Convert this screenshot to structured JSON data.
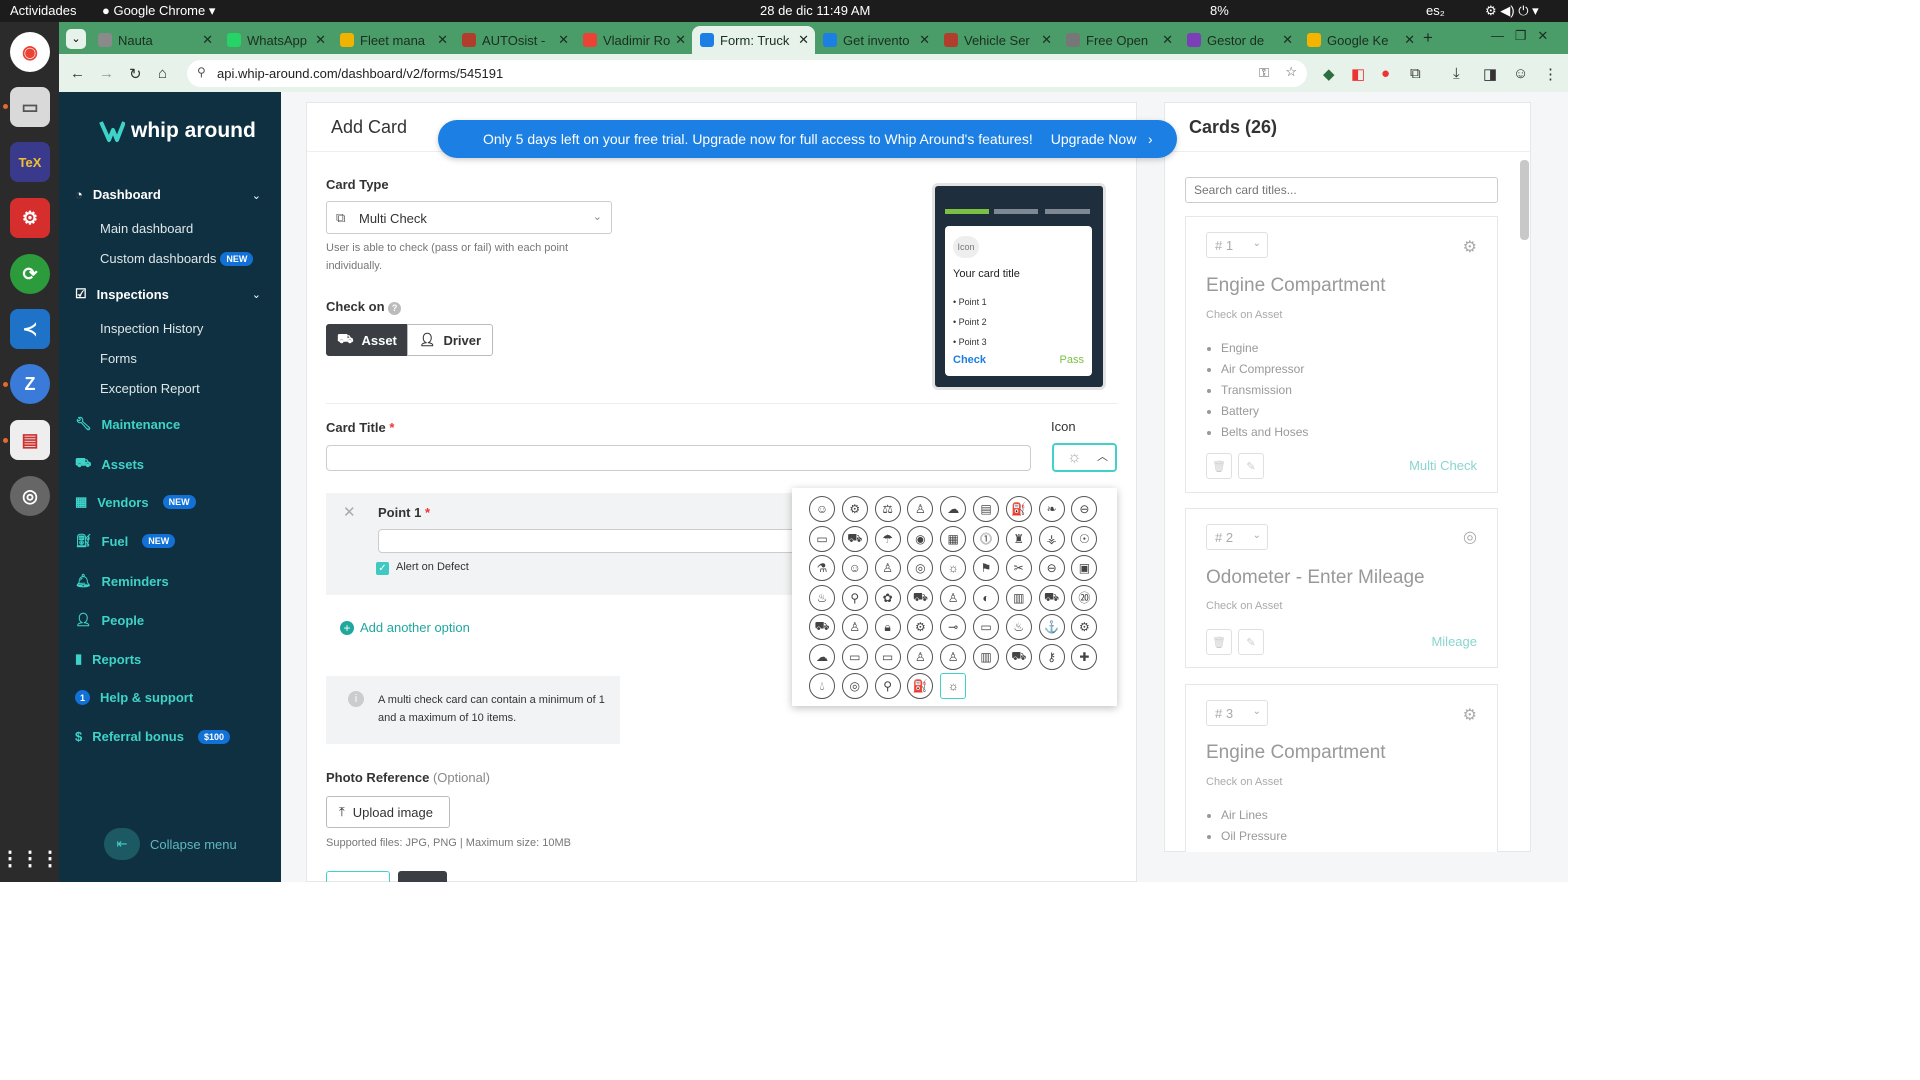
{
  "system": {
    "activities": "Actividades",
    "app": "Google Chrome",
    "clock": "28 de dic  11:49 AM",
    "battery": "8%",
    "lang": "es₂"
  },
  "browser": {
    "tabs": [
      {
        "label": "Nauta",
        "color": "#8a8a8a"
      },
      {
        "label": "WhatsApp",
        "color": "#25d366"
      },
      {
        "label": "Fleet mana",
        "color": "#f0b400"
      },
      {
        "label": "AUTOsist -",
        "color": "#b13d2c"
      },
      {
        "label": "Vladimir Ro",
        "color": "#ea4335"
      },
      {
        "label": "Form: Truck",
        "color": "#1b7fe3"
      },
      {
        "label": "Get invento",
        "color": "#1b7fe3"
      },
      {
        "label": "Vehicle Ser",
        "color": "#b13d2c"
      },
      {
        "label": "Free Open",
        "color": "#777"
      },
      {
        "label": "Gestor de",
        "color": "#7b3fb8"
      },
      {
        "label": "Google Ke",
        "color": "#f4b400"
      }
    ],
    "url": "api.whip-around.com/dashboard/v2/forms/545191"
  },
  "sidebar": {
    "logo": "whip around",
    "items": [
      {
        "label": "Dashboard"
      },
      {
        "label": "Main dashboard"
      },
      {
        "label": "Custom dashboards",
        "badge": "NEW"
      },
      {
        "label": "Inspections"
      },
      {
        "label": "Inspection History"
      },
      {
        "label": "Forms"
      },
      {
        "label": "Exception Report"
      },
      {
        "label": "Maintenance"
      },
      {
        "label": "Assets"
      },
      {
        "label": "Vendors",
        "badge": "NEW"
      },
      {
        "label": "Fuel",
        "badge": "NEW"
      },
      {
        "label": "Reminders"
      },
      {
        "label": "People"
      },
      {
        "label": "Reports"
      },
      {
        "label": "Help & support"
      },
      {
        "label": "Referral bonus",
        "badge": "$100"
      }
    ],
    "collapse": "Collapse menu"
  },
  "banner": {
    "text": "Only 5 days left on your free trial. Upgrade now for full access to Whip Around's features!",
    "cta": "Upgrade Now"
  },
  "form": {
    "title": "Add Card",
    "card_type_label": "Card Type",
    "card_type_value": "Multi Check",
    "card_type_help": "User is able to check (pass or fail) with each point individually.",
    "check_on_label": "Check on",
    "check_on_options": [
      "Asset",
      "Driver"
    ],
    "card_title_label": "Card Title",
    "icon_label": "Icon",
    "point_label": "Point 1",
    "alert_label": "Alert on Defect",
    "add_option": "Add another option",
    "note": "A multi check card can contain a minimum of 1 and a maximum of 10 items.",
    "photo_label": "Photo Reference",
    "photo_optional": "(Optional)",
    "upload": "Upload image",
    "supported": "Supported files: JPG, PNG | Maximum size: 10MB"
  },
  "preview": {
    "icon": "Icon",
    "title": "Your card title",
    "points": [
      "Point 1",
      "Point 2",
      "Point 3"
    ],
    "check": "Check",
    "pass": "Pass"
  },
  "cards_panel": {
    "title": "Cards (26)",
    "search_placeholder": "Search card titles...",
    "cards": [
      {
        "num": "# 1",
        "title": "Engine Compartment",
        "check_on": "Check on Asset",
        "items": [
          "Engine",
          "Air Compressor",
          "Transmission",
          "Battery",
          "Belts and Hoses"
        ],
        "type": "Multi Check"
      },
      {
        "num": "# 2",
        "title": "Odometer - Enter Mileage",
        "check_on": "Check on Asset",
        "type": "Mileage"
      },
      {
        "num": "# 3",
        "title": "Engine Compartment",
        "check_on": "Check on Asset",
        "items": [
          "Air Lines",
          "Oil Pressure"
        ]
      }
    ]
  }
}
